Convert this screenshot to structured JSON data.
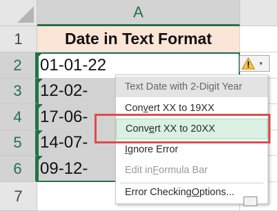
{
  "colors": {
    "accent": "#217346",
    "header_fill": "#fbe5d6",
    "highlight": "#e04a4a",
    "hover": "#d9f0e3"
  },
  "column_header": "A",
  "row_numbers": [
    "1",
    "2",
    "3",
    "4",
    "5",
    "6",
    "7"
  ],
  "cells": {
    "a1": "Date in Text Format",
    "a2": "01-01-22",
    "a3": "12-02-",
    "a4": "17-06-",
    "a5": "14-07-",
    "a6": "09-12-"
  },
  "error_button": {
    "icon": "warning-icon",
    "caret": "▾"
  },
  "error_menu": {
    "title": "Text Date with 2-Digit Year",
    "convert19_pre": "Con",
    "convert19_u": "v",
    "convert19_post": "ert XX to 19XX",
    "convert20_pre": "Conv",
    "convert20_u": "e",
    "convert20_post": "rt XX to 20XX",
    "ignore_pre": "",
    "ignore_u": "I",
    "ignore_post": "gnore Error",
    "edit_pre": "Edit in ",
    "edit_u": "F",
    "edit_post": "ormula Bar",
    "options_pre": "Error Checking ",
    "options_u": "O",
    "options_post": "ptions..."
  }
}
